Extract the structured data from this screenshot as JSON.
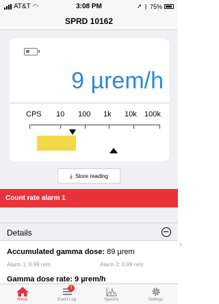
{
  "status_bar": {
    "carrier": "AT&T",
    "time": "3:08 PM",
    "battery": "75%"
  },
  "nav": {
    "title": "SPRD 10162"
  },
  "reading": {
    "dose_rate": "9 µrem/h",
    "scale_labels": [
      "CPS",
      "10",
      "100",
      "1k",
      "10k",
      "100k"
    ]
  },
  "store_button": {
    "label": "Store reading",
    "icon": "download-icon"
  },
  "alarm": {
    "message": "Count rate alarm 1"
  },
  "details": {
    "title": "Details",
    "accumulated_label": "Accumulated gamma dose:",
    "accumulated_value": " 89 µrem",
    "alarm_1": "Alarm 1: 0.99 rem",
    "alarm_2": "Alarm 2: 0.99 rem",
    "next_row": "Gamma dose rate: 9 µrem/h"
  },
  "tabs": [
    {
      "label": "Home",
      "icon": "home-icon",
      "active": true
    },
    {
      "label": "Event Log",
      "icon": "list-icon",
      "badge": "!"
    },
    {
      "label": "Spectra",
      "icon": "spectrum-icon"
    },
    {
      "label": "Settings",
      "icon": "gear-icon"
    }
  ],
  "colors": {
    "accent": "#2f86d6",
    "alarm": "#e8333a",
    "level": "#f1d94a"
  }
}
